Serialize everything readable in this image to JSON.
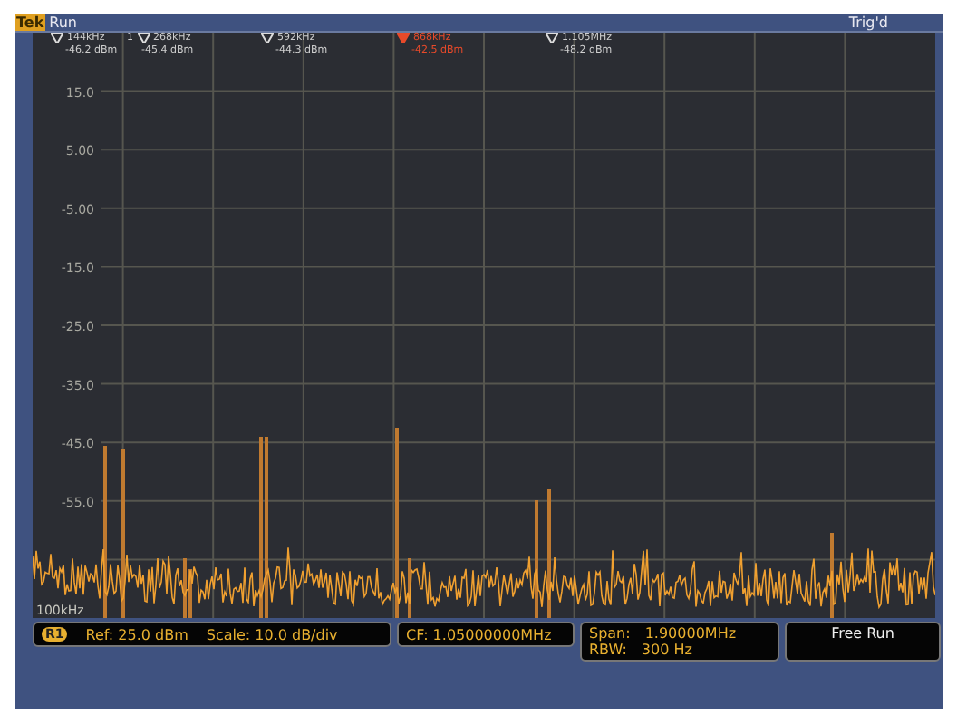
{
  "header": {
    "logo": "Tek",
    "mode": "Run",
    "trigger": "Trig'd"
  },
  "markers": [
    {
      "frequency": "144kHz",
      "amplitude": "-46.2 dBm",
      "selected": false
    },
    {
      "number": "1",
      "frequency": "268kHz",
      "amplitude": "-45.4 dBm",
      "selected": false
    },
    {
      "frequency": "592kHz",
      "amplitude": "-44.3 dBm",
      "selected": false
    },
    {
      "frequency": "868kHz",
      "amplitude": "-42.5 dBm",
      "selected": true
    },
    {
      "frequency": "1.105MHz",
      "amplitude": "-48.2 dBm",
      "selected": false
    }
  ],
  "y_labels": [
    "15.0",
    "5.00",
    "-5.00",
    "-15.0",
    "-25.0",
    "-35.0",
    "-45.0",
    "-55.0"
  ],
  "x_start": "100kHz",
  "status": {
    "badge": "R1",
    "ref": "Ref: 25.0 dBm",
    "scale": "Scale: 10.0 dB/div",
    "cf": "CF:  1.05000000MHz",
    "span_label": "Span:",
    "span": "1.90000MHz",
    "rbw_label": "RBW:",
    "rbw": "300 Hz",
    "run_mode": "Free Run"
  }
}
